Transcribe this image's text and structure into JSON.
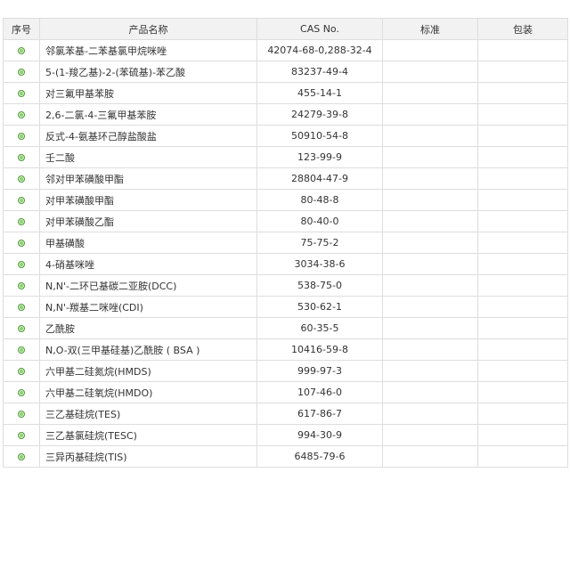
{
  "table": {
    "headers": {
      "index": "序号",
      "name": "产品名称",
      "cas": "CAS No.",
      "standard": "标准",
      "package": "包装"
    },
    "bullet_icon": "green-dot-icon",
    "bullet_color": "#8bd06a",
    "rows": [
      {
        "name": "邻氯苯基-二苯基氯甲烷咪唑",
        "cas": "42074-68-0,288-32-4",
        "standard": "",
        "package": ""
      },
      {
        "name": "5-(1-羧乙基)-2-(苯硫基)-苯乙酸",
        "cas": "83237-49-4",
        "standard": "",
        "package": ""
      },
      {
        "name": "对三氟甲基苯胺",
        "cas": "455-14-1",
        "standard": "",
        "package": ""
      },
      {
        "name": "2,6-二氯-4-三氟甲基苯胺",
        "cas": "24279-39-8",
        "standard": "",
        "package": ""
      },
      {
        "name": "反式-4-氨基环己醇盐酸盐",
        "cas": "50910-54-8",
        "standard": "",
        "package": ""
      },
      {
        "name": "壬二酸",
        "cas": "123-99-9",
        "standard": "",
        "package": ""
      },
      {
        "name": "邻对甲苯磺酸甲酯",
        "cas": "28804-47-9",
        "standard": "",
        "package": ""
      },
      {
        "name": "对甲苯磺酸甲酯",
        "cas": "80-48-8",
        "standard": "",
        "package": ""
      },
      {
        "name": "对甲苯磺酸乙酯",
        "cas": "80-40-0",
        "standard": "",
        "package": ""
      },
      {
        "name": "甲基磺酸",
        "cas": "75-75-2",
        "standard": "",
        "package": ""
      },
      {
        "name": "4-硝基咪唑",
        "cas": "3034-38-6",
        "standard": "",
        "package": ""
      },
      {
        "name": "N,N'-二环已基碳二亚胺(DCC)",
        "cas": "538-75-0",
        "standard": "",
        "package": ""
      },
      {
        "name": "N,N'-羰基二咪唑(CDI)",
        "cas": "530-62-1",
        "standard": "",
        "package": ""
      },
      {
        "name": "乙酰胺",
        "cas": "60-35-5",
        "standard": "",
        "package": ""
      },
      {
        "name": "N,O-双(三甲基硅基)乙酰胺 ( BSA )",
        "cas": "10416-59-8",
        "standard": "",
        "package": ""
      },
      {
        "name": "六甲基二硅氮烷(HMDS)",
        "cas": "999-97-3",
        "standard": "",
        "package": ""
      },
      {
        "name": "六甲基二硅氧烷(HMDO)",
        "cas": "107-46-0",
        "standard": "",
        "package": ""
      },
      {
        "name": "三乙基硅烷(TES)",
        "cas": "617-86-7",
        "standard": "",
        "package": ""
      },
      {
        "name": "三乙基氯硅烷(TESC)",
        "cas": "994-30-9",
        "standard": "",
        "package": ""
      },
      {
        "name": "三异丙基硅烷(TIS)",
        "cas": "6485-79-6",
        "standard": "",
        "package": ""
      }
    ]
  }
}
